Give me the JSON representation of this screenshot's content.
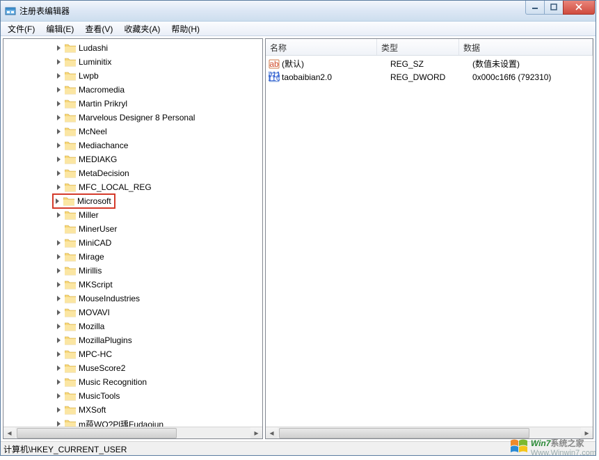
{
  "window": {
    "title": "注册表编辑器"
  },
  "menus": [
    {
      "label": "文件(F)"
    },
    {
      "label": "编辑(E)"
    },
    {
      "label": "查看(V)"
    },
    {
      "label": "收藏夹(A)"
    },
    {
      "label": "帮助(H)"
    }
  ],
  "tree": [
    {
      "label": "Ludashi",
      "exp": true
    },
    {
      "label": "Luminitix",
      "exp": true
    },
    {
      "label": "Lwpb",
      "exp": true
    },
    {
      "label": "Macromedia",
      "exp": true
    },
    {
      "label": "Martin Prikryl",
      "exp": true
    },
    {
      "label": "Marvelous Designer 8 Personal",
      "exp": true
    },
    {
      "label": "McNeel",
      "exp": true
    },
    {
      "label": "Mediachance",
      "exp": true
    },
    {
      "label": "MEDIAKG",
      "exp": true
    },
    {
      "label": "MetaDecision",
      "exp": true
    },
    {
      "label": "MFC_LOCAL_REG",
      "exp": true
    },
    {
      "label": "Microsoft",
      "exp": true,
      "highlight": true
    },
    {
      "label": "Miller",
      "exp": true
    },
    {
      "label": "MinerUser",
      "exp": false
    },
    {
      "label": "MiniCAD",
      "exp": true
    },
    {
      "label": "Mirage",
      "exp": true
    },
    {
      "label": "Mirillis",
      "exp": true
    },
    {
      "label": "MKScript",
      "exp": true
    },
    {
      "label": "MouseIndustries",
      "exp": true
    },
    {
      "label": "MOVAVI",
      "exp": true
    },
    {
      "label": "Mozilla",
      "exp": true
    },
    {
      "label": "MozillaPlugins",
      "exp": true
    },
    {
      "label": "MPC-HC",
      "exp": true
    },
    {
      "label": "MuseScore2",
      "exp": true
    },
    {
      "label": "Music Recognition",
      "exp": true
    },
    {
      "label": "MusicTools",
      "exp": true
    },
    {
      "label": "MXSoft",
      "exp": true
    },
    {
      "label": "m葮WQ?Pl瑀Fudaojun",
      "exp": true
    }
  ],
  "listHeader": {
    "name": "名称",
    "type": "类型",
    "data": "数据"
  },
  "values": [
    {
      "icon": "string",
      "name": "(默认)",
      "type": "REG_SZ",
      "data": "(数值未设置)"
    },
    {
      "icon": "binary",
      "name": "taobaibian2.0",
      "type": "REG_DWORD",
      "data": "0x000c16f6 (792310)"
    }
  ],
  "status": "计算机\\HKEY_CURRENT_USER",
  "watermark": {
    "line1a": "Win7",
    "line1b": "系统之家",
    "line2": "Www.Winwin7.com"
  }
}
